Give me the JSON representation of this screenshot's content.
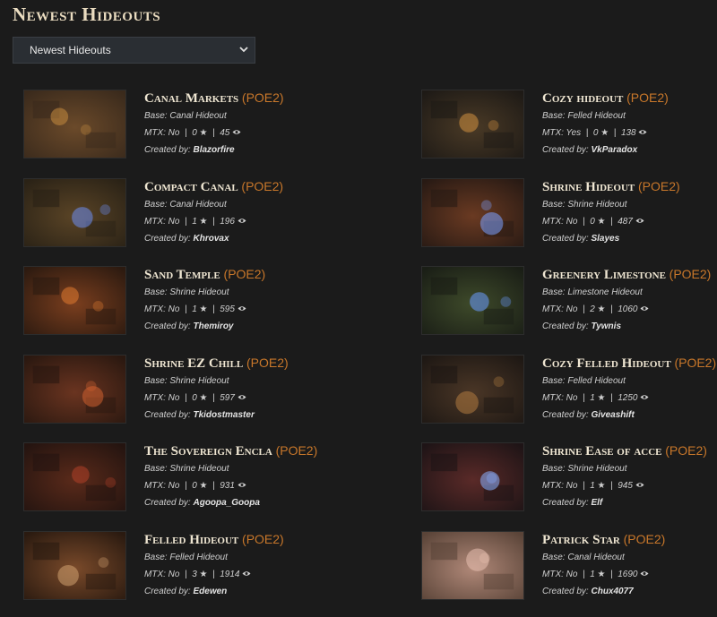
{
  "page": {
    "title": "Newest Hideouts"
  },
  "filter": {
    "selected": "Newest Hideouts"
  },
  "labels": {
    "base_prefix": "Base:",
    "mtx_prefix": "MTX:",
    "created_prefix": "Created by:"
  },
  "hideouts": [
    {
      "name": "Canal Markets",
      "tag": "(POE2)",
      "base": "Canal Hideout",
      "mtx": "No",
      "stars": "0",
      "views": "45",
      "creator": "Blazorfire",
      "palette": [
        "#3a2a1c",
        "#6b4a2a",
        "#c48a3e"
      ]
    },
    {
      "name": "Cozy hideout",
      "tag": "(POE2)",
      "base": "Felled Hideout",
      "mtx": "Yes",
      "stars": "0",
      "views": "138",
      "creator": "VkParadox",
      "palette": [
        "#1e1a16",
        "#4a3a26",
        "#d09040"
      ]
    },
    {
      "name": "Compact Canal",
      "tag": "(POE2)",
      "base": "Canal Hideout",
      "mtx": "No",
      "stars": "1",
      "views": "196",
      "creator": "Khrovax",
      "palette": [
        "#2a2216",
        "#5a4426",
        "#6b8cf0"
      ]
    },
    {
      "name": "Shrine Hideout",
      "tag": "(POE2)",
      "base": "Shrine Hideout",
      "mtx": "No",
      "stars": "0",
      "views": "487",
      "creator": "Slayes",
      "palette": [
        "#281a14",
        "#6a3a22",
        "#7aa0ff"
      ]
    },
    {
      "name": "Sand Temple",
      "tag": "(POE2)",
      "base": "Shrine Hideout",
      "mtx": "No",
      "stars": "1",
      "views": "595",
      "creator": "Themiroy",
      "palette": [
        "#2c1a10",
        "#7a3e1e",
        "#e07a30"
      ]
    },
    {
      "name": "Greenery Limestone",
      "tag": "(POE2)",
      "base": "Limestone Hideout",
      "mtx": "No",
      "stars": "2",
      "views": "1060",
      "creator": "Tywnis",
      "palette": [
        "#1a1e16",
        "#3e4a2a",
        "#6a9aff"
      ]
    },
    {
      "name": "Shrine EZ Chill",
      "tag": "(POE2)",
      "base": "Shrine Hideout",
      "mtx": "No",
      "stars": "0",
      "views": "597",
      "creator": "Tkidostmaster",
      "palette": [
        "#2a1810",
        "#6a3420",
        "#d06030"
      ]
    },
    {
      "name": "Cozy Felled Hideout",
      "tag": "(POE2)",
      "base": "Felled Hideout",
      "mtx": "No",
      "stars": "1",
      "views": "1250",
      "creator": "Giveashift",
      "palette": [
        "#1e1814",
        "#4a3626",
        "#b07a40"
      ]
    },
    {
      "name": "The Sovereign Encla",
      "tag": "(POE2)",
      "base": "Shrine Hideout",
      "mtx": "No",
      "stars": "0",
      "views": "931",
      "creator": "Agoopa_Goopa",
      "palette": [
        "#241410",
        "#5a2a1a",
        "#b04028"
      ]
    },
    {
      "name": "Shrine Ease of acce",
      "tag": "(POE2)",
      "base": "Shrine Hideout",
      "mtx": "No",
      "stars": "1",
      "views": "945",
      "creator": "Elf",
      "palette": [
        "#1e1416",
        "#5a2a28",
        "#8ab0ff"
      ]
    },
    {
      "name": "Felled Hideout",
      "tag": "(POE2)",
      "base": "Felled Hideout",
      "mtx": "No",
      "stars": "3",
      "views": "1914",
      "creator": "Edewen",
      "palette": [
        "#2a1a10",
        "#7a4a2a",
        "#d0a070"
      ]
    },
    {
      "name": "Patrick Star",
      "tag": "(POE2)",
      "base": "Canal Hideout",
      "mtx": "No",
      "stars": "1",
      "views": "1690",
      "creator": "Chux4077",
      "palette": [
        "#5a4438",
        "#b08878",
        "#e8c0b0"
      ]
    }
  ]
}
